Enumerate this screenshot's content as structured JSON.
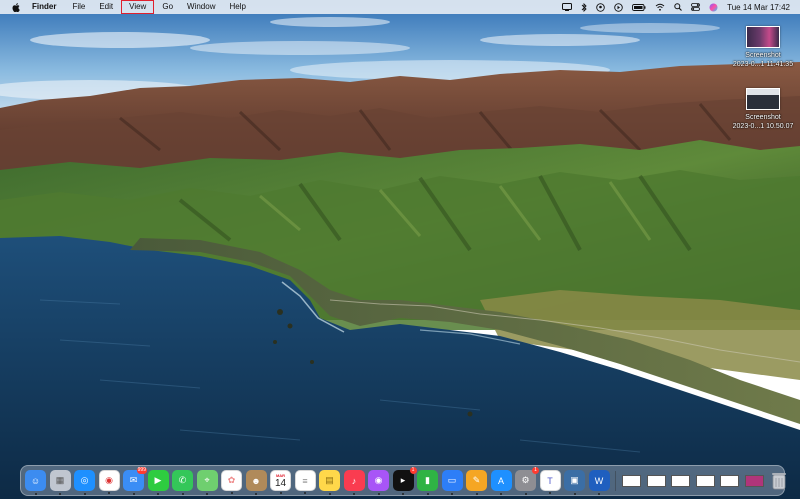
{
  "menubar": {
    "app_name": "Finder",
    "items": [
      "File",
      "Edit",
      "View",
      "Go",
      "Window",
      "Help"
    ],
    "highlighted_item": "View",
    "clock": "Tue 14 Mar  17:42",
    "status_icons": [
      "screen-mirror-icon",
      "bluetooth-icon",
      "vpn-icon",
      "play-icon",
      "battery-icon",
      "wifi-icon",
      "spotlight-search-icon",
      "control-center-icon",
      "siri-icon"
    ]
  },
  "desktop_icons": [
    {
      "name": "Screenshot",
      "subtitle": "2023-0...1 11.41.35"
    },
    {
      "name": "Screenshot",
      "subtitle": "2023-0...1 10.50.07"
    }
  ],
  "dock": {
    "apps": [
      {
        "name": "finder-icon",
        "color": "#3c8cf0"
      },
      {
        "name": "launchpad-icon",
        "color": "#c0c6d0"
      },
      {
        "name": "safari-icon",
        "color": "#1e90ff"
      },
      {
        "name": "chrome-icon",
        "color": "#ffffff"
      },
      {
        "name": "mail-icon",
        "color": "#3a8df5",
        "badge": "999"
      },
      {
        "name": "facetime-icon",
        "color": "#2ecc40"
      },
      {
        "name": "messages-icon",
        "color": "#34c759"
      },
      {
        "name": "maps-icon",
        "color": "#6fcf6f"
      },
      {
        "name": "photos-icon",
        "color": "#ffffff"
      },
      {
        "name": "contacts-icon",
        "color": "#b08a5a"
      },
      {
        "name": "calendar-icon",
        "color": "#ffffff",
        "month": "MAR",
        "day": "14"
      },
      {
        "name": "reminders-icon",
        "color": "#ffffff"
      },
      {
        "name": "notes-icon",
        "color": "#ffd84a"
      },
      {
        "name": "music-icon",
        "color": "#fa3c50"
      },
      {
        "name": "podcasts-icon",
        "color": "#a855f7"
      },
      {
        "name": "appletv-icon",
        "color": "#111111",
        "badge": "1"
      },
      {
        "name": "numbers-icon",
        "color": "#2fb344"
      },
      {
        "name": "keynote-icon",
        "color": "#2d7ef7"
      },
      {
        "name": "pages-icon",
        "color": "#f5a623"
      },
      {
        "name": "appstore-icon",
        "color": "#1e90ff"
      },
      {
        "name": "system-settings-icon",
        "color": "#8e8e93",
        "badge": "1"
      },
      {
        "name": "teams-icon",
        "color": "#ffffff"
      },
      {
        "name": "preview-icon",
        "color": "#3b6ea5"
      },
      {
        "name": "word-icon",
        "color": "#1f5fbf"
      }
    ],
    "right_items": [
      {
        "name": "downloads-stack-icon",
        "color": "#ffffff"
      },
      {
        "name": "recent-window-1-icon",
        "color": "#ffffff"
      },
      {
        "name": "recent-window-2-icon",
        "color": "#ffffff"
      },
      {
        "name": "recent-window-3-icon",
        "color": "#ffffff"
      },
      {
        "name": "recent-window-4-icon",
        "color": "#ffffff"
      },
      {
        "name": "recent-window-5-icon",
        "color": "#b0357a"
      },
      {
        "name": "trash-icon",
        "color": "#c8ccd2"
      }
    ]
  },
  "colors": {
    "highlight_box": "#e0202e",
    "sky_top": "#3a7ec4",
    "ocean": "#1c4d78"
  }
}
